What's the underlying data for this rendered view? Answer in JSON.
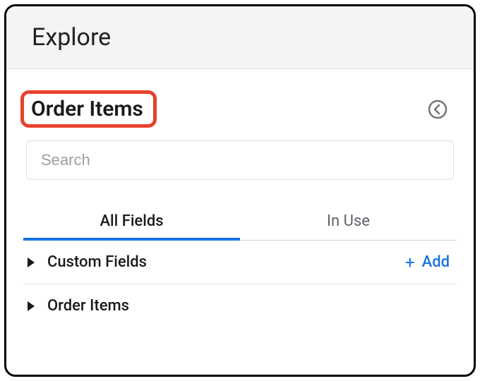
{
  "header": {
    "title": "Explore"
  },
  "explore": {
    "name": "Order Items",
    "search_placeholder": "Search"
  },
  "tabs": {
    "all_fields": "All Fields",
    "in_use": "In Use"
  },
  "sections": {
    "custom_fields": {
      "label": "Custom Fields",
      "add_label": "Add"
    },
    "order_items": {
      "label": "Order Items"
    }
  },
  "highlight_color": "#e8412e",
  "accent_color": "#1a73e8"
}
